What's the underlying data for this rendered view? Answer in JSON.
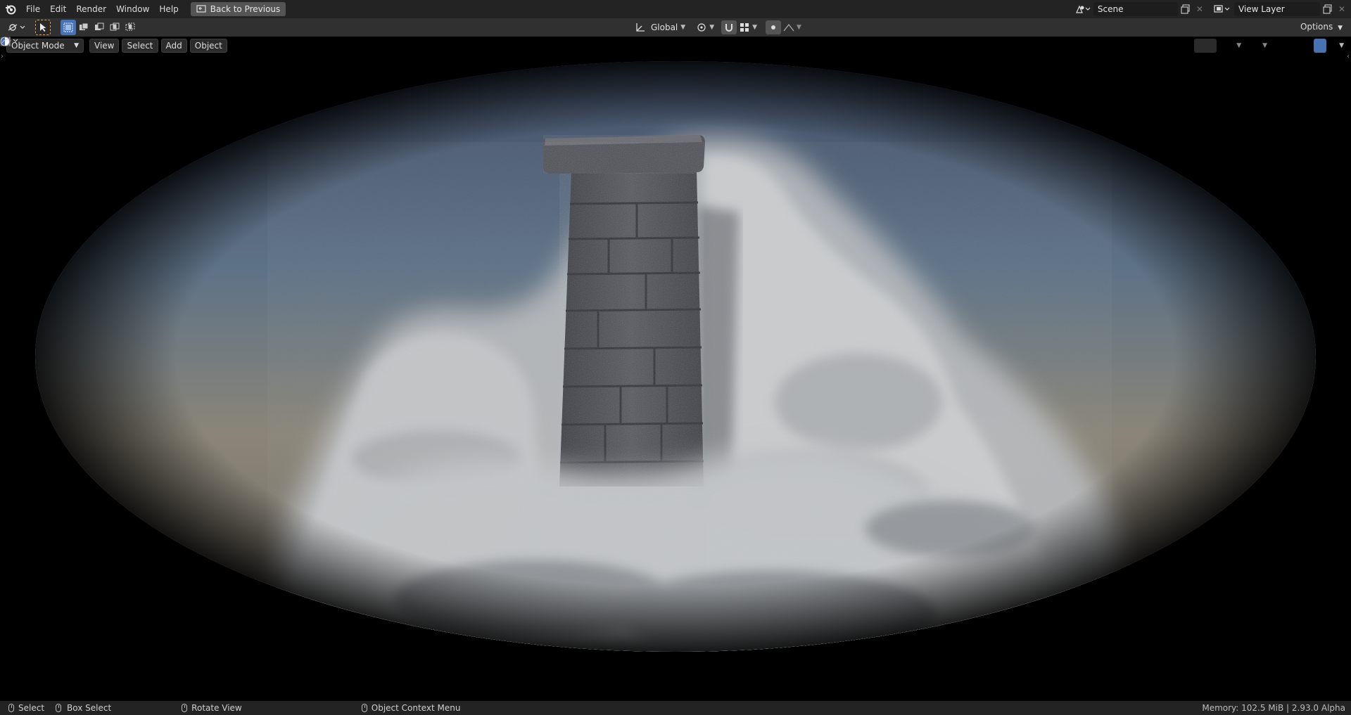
{
  "menu": {
    "items": [
      "File",
      "Edit",
      "Render",
      "Window",
      "Help"
    ],
    "back_button": "Back to Previous"
  },
  "scene": {
    "name": "Scene"
  },
  "view_layer": {
    "name": "View Layer"
  },
  "toolbar": {
    "orientation": "Global",
    "options": "Options"
  },
  "view_header": {
    "mode": "Object Mode",
    "menus": [
      "View",
      "Select",
      "Add",
      "Object"
    ]
  },
  "status": {
    "select": "Select",
    "box_select": "Box Select",
    "rotate_view": "Rotate View",
    "context_menu": "Object Context Menu",
    "memory": "Memory: 102.5 MiB | 2.93.0 Alpha"
  },
  "colors": {
    "topbar": "#232323",
    "toolbar": "#303030",
    "accent": "#4772b3",
    "select_orange": "#e8a33c",
    "sky_top": "#4c5c78",
    "sky_bottom": "#8c8270",
    "stone": "#4a4a52"
  }
}
